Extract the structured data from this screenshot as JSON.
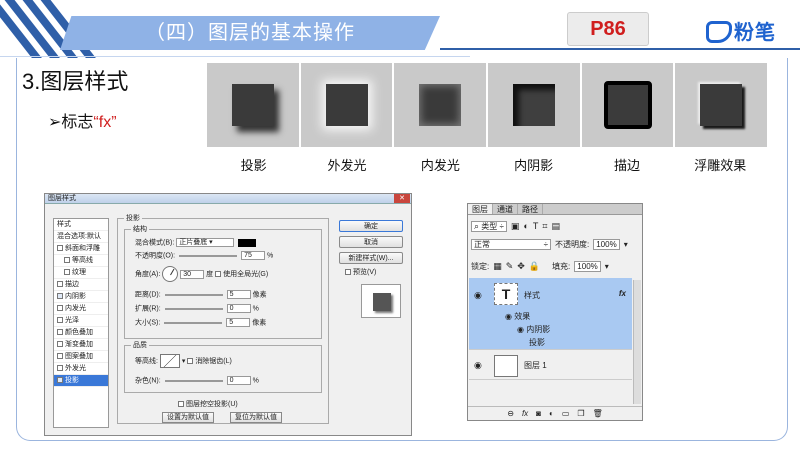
{
  "header": {
    "title": "（四）图层的基本操作",
    "page": "P86",
    "logo": "粉笔",
    "logo_mark": "Fb"
  },
  "section": {
    "title": "3.图层样式",
    "bullet_prefix": "➢标志",
    "bullet_fx": "“fx”"
  },
  "effects": [
    {
      "name": "drop-shadow",
      "label": "投影"
    },
    {
      "name": "outer-glow",
      "label": "外发光"
    },
    {
      "name": "inner-glow",
      "label": "内发光"
    },
    {
      "name": "inner-shadow",
      "label": "内阴影"
    },
    {
      "name": "stroke",
      "label": "描边"
    },
    {
      "name": "emboss",
      "label": "浮雕效果"
    }
  ],
  "dialog": {
    "title": "图层样式",
    "close": "✕",
    "style_list": [
      {
        "label": "样式",
        "check": false,
        "sel": false
      },
      {
        "label": "混合选项:默认",
        "check": false,
        "sel": false
      },
      {
        "label": "斜面和浮雕",
        "check": true,
        "sel": false
      },
      {
        "label": "等高线",
        "check": true,
        "sel": false,
        "indent": true
      },
      {
        "label": "纹理",
        "check": true,
        "sel": false,
        "indent": true
      },
      {
        "label": "描边",
        "check": true,
        "sel": false
      },
      {
        "label": "内阴影",
        "check": true,
        "checked": true,
        "sel": false
      },
      {
        "label": "内发光",
        "check": true,
        "sel": false
      },
      {
        "label": "光泽",
        "check": true,
        "sel": false
      },
      {
        "label": "颜色叠加",
        "check": true,
        "sel": false
      },
      {
        "label": "渐变叠加",
        "check": true,
        "sel": false
      },
      {
        "label": "图案叠加",
        "check": true,
        "sel": false
      },
      {
        "label": "外发光",
        "check": true,
        "sel": false
      },
      {
        "label": "投影",
        "check": true,
        "checked": true,
        "sel": true
      }
    ],
    "group_main": "投影",
    "group_struct": "结构",
    "blend_mode_label": "混合模式(B):",
    "blend_mode": "正片叠底",
    "opacity_label": "不透明度(O):",
    "opacity": "75",
    "angle_label": "角度(A):",
    "angle": "30",
    "angle_unit": "度",
    "global_light": "使用全局光(G)",
    "distance_label": "距离(D):",
    "distance": "5",
    "spread_label": "扩展(R):",
    "spread": "0",
    "size_label": "大小(S):",
    "size": "5",
    "px": "像素",
    "pct": "%",
    "group_quality": "品质",
    "contour_label": "等高线:",
    "antialias": "消除锯齿(L)",
    "noise_label": "杂色(N):",
    "noise": "0",
    "knockout": "图层挖空投影(U)",
    "set_default": "设置为默认值",
    "reset_default": "复位为默认值",
    "buttons": {
      "ok": "确定",
      "cancel": "取消",
      "new_style": "新建样式(W)...",
      "preview": "预览(V)"
    }
  },
  "layers_panel": {
    "tabs": [
      "图层",
      "通道",
      "路径"
    ],
    "kind_label": "类型",
    "blend": "正常",
    "opacity_label": "不透明度:",
    "opacity": "100%",
    "lock_label": "锁定:",
    "fill_label": "填充:",
    "fill": "100%",
    "text_layer": "样式",
    "text_thumb": "T",
    "fx_badge": "fx",
    "effects_label": "效果",
    "effect_items": [
      "内阴影",
      "投影"
    ],
    "layer1": "图层 1",
    "footer_icons": [
      "link-icon",
      "fx-icon",
      "mask-icon",
      "adjustment-icon",
      "folder-icon",
      "new-layer-icon",
      "trash-icon"
    ]
  }
}
